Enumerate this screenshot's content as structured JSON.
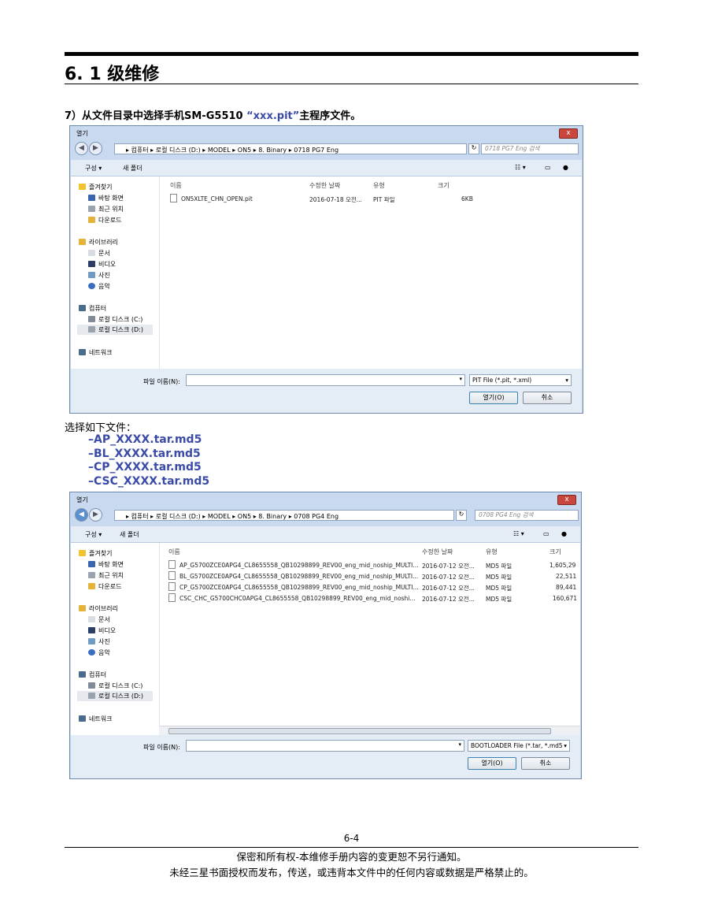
{
  "heading": "6. 1 级维修",
  "step": {
    "prefix": "7）从文件目录中选择手机SM-G5510 ",
    "highlight": "“xxx.pit”",
    "suffix": "主程序文件。"
  },
  "select_label": "选择如下文件：",
  "files": [
    "–AP_XXXX.tar.md5",
    "–BL_XXXX.tar.md5",
    "–CP_XXXX.tar.md5",
    "–CSC_XXXX.tar.md5"
  ],
  "page_number": "6-4",
  "footer": [
    "保密和所有权-本维修手册内容的变更恕不另行通知。",
    "未经三星书面授权而发布，传送，或违背本文件中的任何内容或数据是严格禁止的。"
  ],
  "dialog1": {
    "title": "열기",
    "close": "x",
    "crumbs": "▸ 컴퓨터 ▸ 로컬 디스크 (D:) ▸ MODEL ▸ ON5 ▸ 8. Binary ▸ 0718 PG7 Eng",
    "search": "0718 PG7 Eng 검색",
    "organize": "구성 ▾",
    "new_folder": "새 폴더",
    "columns": [
      "이름",
      "수정한 날짜",
      "유형",
      "크기"
    ],
    "rows": [
      {
        "name": "ON5XLTE_CHN_OPEN.pit",
        "date": "2016-07-18 오전...",
        "type": "PIT 파일",
        "size": "6KB"
      }
    ],
    "filename_label": "파일 이름(N):",
    "filter": "PIT File (*.pit, *.xml)",
    "open": "열기(O)",
    "cancel": "취소"
  },
  "dialog2": {
    "title": "열기",
    "close": "x",
    "crumbs": "▸ 컴퓨터 ▸ 로컬 디스크 (D:) ▸ MODEL ▸ ON5 ▸ 8. Binary ▸ 0708 PG4 Eng",
    "search": "0708 PG4 Eng 검색",
    "organize": "구성 ▾",
    "new_folder": "새 폴더",
    "columns": [
      "이름",
      "수정한 날짜",
      "유형",
      "크기"
    ],
    "rows": [
      {
        "name": "AP_G5700ZCE0APG4_CL8655558_QB10298899_REV00_eng_mid_noship_MULTI...",
        "date": "2016-07-12 오전...",
        "type": "MD5 파일",
        "size": "1,605,29"
      },
      {
        "name": "BL_G5700ZCE0APG4_CL8655558_QB10298899_REV00_eng_mid_noship_MULTI...",
        "date": "2016-07-12 오전...",
        "type": "MD5 파일",
        "size": "22,511"
      },
      {
        "name": "CP_G5700ZCE0APG4_CL8655558_QB10298899_REV00_eng_mid_noship_MULTI...",
        "date": "2016-07-12 오전...",
        "type": "MD5 파일",
        "size": "89,441"
      },
      {
        "name": "CSC_CHC_G5700CHC0APG4_CL8655558_QB10298899_REV00_eng_mid_noshi...",
        "date": "2016-07-12 오전...",
        "type": "MD5 파일",
        "size": "160,671"
      }
    ],
    "filename_label": "파일 이름(N):",
    "filter": "BOOTLOADER File (*.tar, *.md5",
    "open": "열기(O)",
    "cancel": "취소"
  },
  "nav": {
    "favorites": "즐겨찾기",
    "desktop": "바탕 화면",
    "recent": "최근 위치",
    "downloads": "다운로드",
    "libraries": "라이브러리",
    "documents": "문서",
    "videos": "비디오",
    "pictures": "사진",
    "music": "음악",
    "computer": "컴퓨터",
    "disk_c": "로컬 디스크 (C:)",
    "disk_d": "로컬 디스크 (D:)",
    "network": "네트워크"
  },
  "colors": {
    "accent_blue": "#3a4aa8",
    "titlebar": "#c9daf0",
    "close": "#c8463c"
  }
}
